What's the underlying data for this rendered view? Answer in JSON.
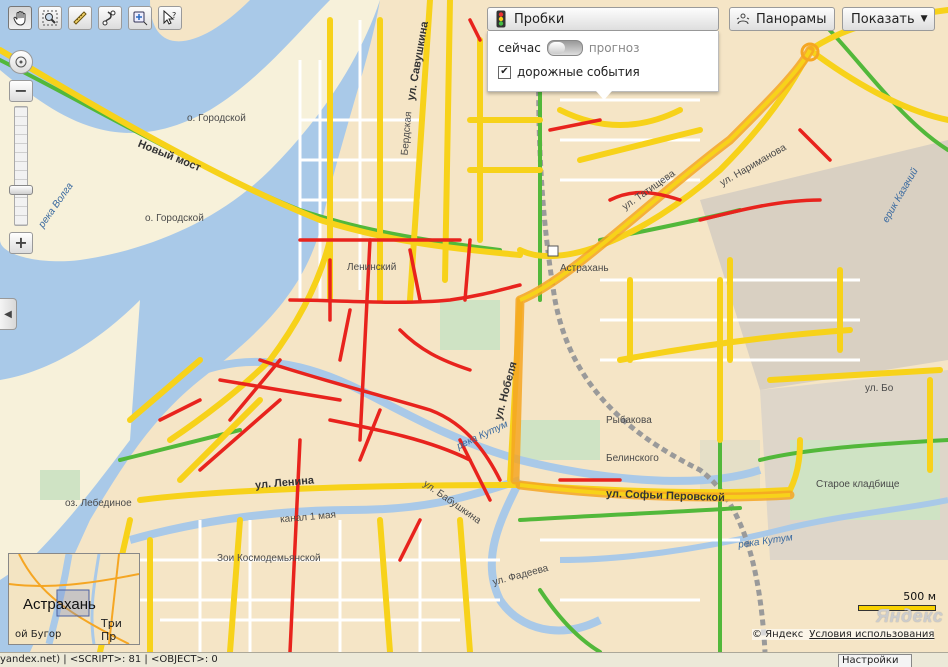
{
  "toolbar": {
    "tools": [
      {
        "name": "pan-tool-button",
        "icon": "hand-icon",
        "active": true
      },
      {
        "name": "magnifier-tool-button",
        "icon": "zoom-area-icon",
        "active": false
      },
      {
        "name": "ruler-tool-button",
        "icon": "ruler-icon",
        "active": false
      },
      {
        "name": "route-tool-button",
        "icon": "route-icon",
        "active": false
      },
      {
        "name": "placemark-tool-button",
        "icon": "placemark-icon",
        "active": false
      },
      {
        "name": "help-tool-button",
        "icon": "help-cursor-icon",
        "active": false
      }
    ]
  },
  "traffic": {
    "title": "Пробки",
    "now_label": "сейчас",
    "forecast_label": "прогноз",
    "events_label": "дорожные события",
    "events_checked": "✔"
  },
  "panorama_label": "Панорамы",
  "show_label": "Показать",
  "show_arrow": "▼",
  "labels": {
    "island1": "о. Городской",
    "island2": "о. Городской",
    "new_bridge": "Новый мост",
    "river_volga": "река Волга",
    "savushkina": "ул. Савушкина",
    "berelskaya": "Бердская",
    "leninsky": "Ленинский",
    "astrakhan_station": "Астрахань",
    "naridmanova": "ул. Наримановa",
    "tatishcheva": "ул. Татищева",
    "kazachy": "ерик Казачий",
    "nobeleva": "ул. Нобеля",
    "lenina": "ул. Ленина",
    "bakinskaya": "ул. Бабушкина",
    "kanal": "канал 1 мая",
    "zoi": "Зои Космодемьянской",
    "reka_kutum": "река Кутум",
    "reka_kutum2": "река Кутум",
    "sovetskaya": "ул. Софьи Перовской",
    "staroe": "Старое кладбище",
    "lebedinoe": "оз. Лебединое",
    "fadeeva": "ул. Фадеева",
    "belinskogo": "Белинского",
    "rueva": "Рыбаковa",
    "ul_boev": "ул. Бо"
  },
  "minimap": {
    "city": "Астрахань",
    "label2": "Три Пр",
    "label3": "ой Бугор"
  },
  "scale_label": "500 м",
  "logo": "Яндекс",
  "copyright": "© Яндекс",
  "terms": "Условия использования",
  "statusbar": {
    "text": "yandex.net) | <SCRIPT>: 81 | <OBJECT>: 0",
    "settings": "Настройки"
  },
  "colors": {
    "jam_red": "#e8231d",
    "slow_yellow": "#f7d21a",
    "free_green": "#52b83a",
    "water": "#a9c9e8",
    "land": "#f5e5c6"
  }
}
